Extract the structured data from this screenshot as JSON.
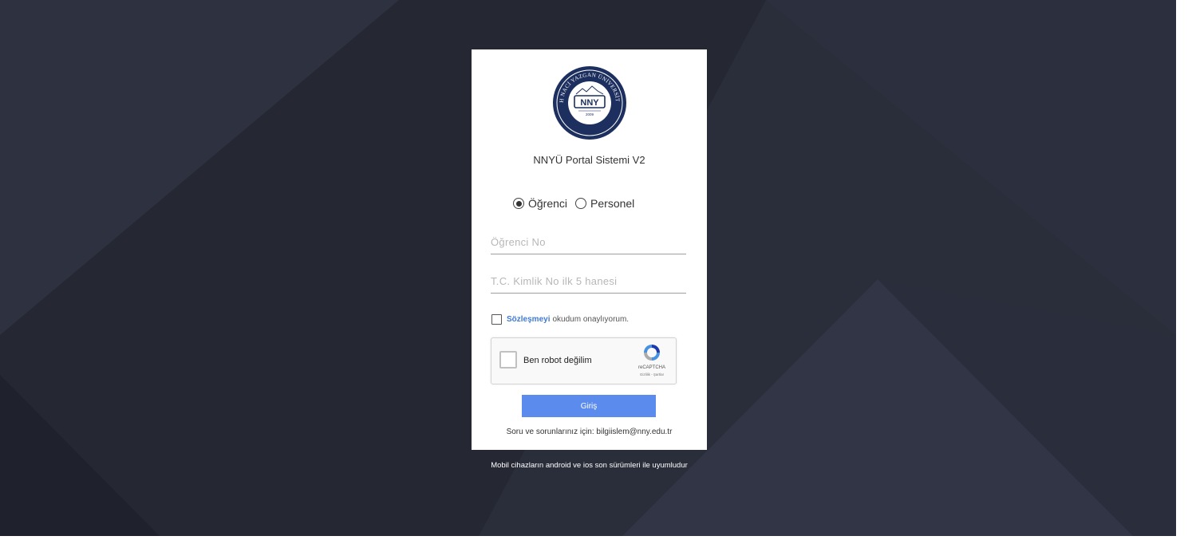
{
  "colors": {
    "background": "#2a2d3a",
    "accent": "#5b8ced",
    "link": "#3f7ad5",
    "logo_navy": "#1c2f5e"
  },
  "logo": {
    "outer_text": "NUH NACİ YAZGAN ÜNİVERSİTESİ",
    "city": "KAYSERİ",
    "abbr": "NNY",
    "year": "2009"
  },
  "portal": {
    "title": "NNYÜ Portal Sistemi V2"
  },
  "user_type": {
    "options": [
      {
        "label": "Öğrenci",
        "checked": true
      },
      {
        "label": "Personel",
        "checked": false
      }
    ]
  },
  "form": {
    "student_no": {
      "placeholder": "Öğrenci No",
      "value": ""
    },
    "tc_no": {
      "placeholder": "T.C. Kimlik No ilk 5 hanesi",
      "value": ""
    }
  },
  "agreement": {
    "checked": false,
    "link_text": "Sözleşmeyi",
    "text": "okudum onaylıyorum."
  },
  "recaptcha": {
    "checked": false,
    "label": "Ben robot değilim",
    "brand": "reCAPTCHA",
    "terms": "Gizlilik - Şartlar",
    "icon": "recaptcha-icon"
  },
  "login": {
    "label": "Giriş"
  },
  "contact": {
    "text": "Soru ve sorunlarınız için: bilgiislem@nny.edu.tr"
  },
  "footer": {
    "mobile_note": "Mobil cihazların android ve ios son sürümleri ile uyumludur"
  }
}
